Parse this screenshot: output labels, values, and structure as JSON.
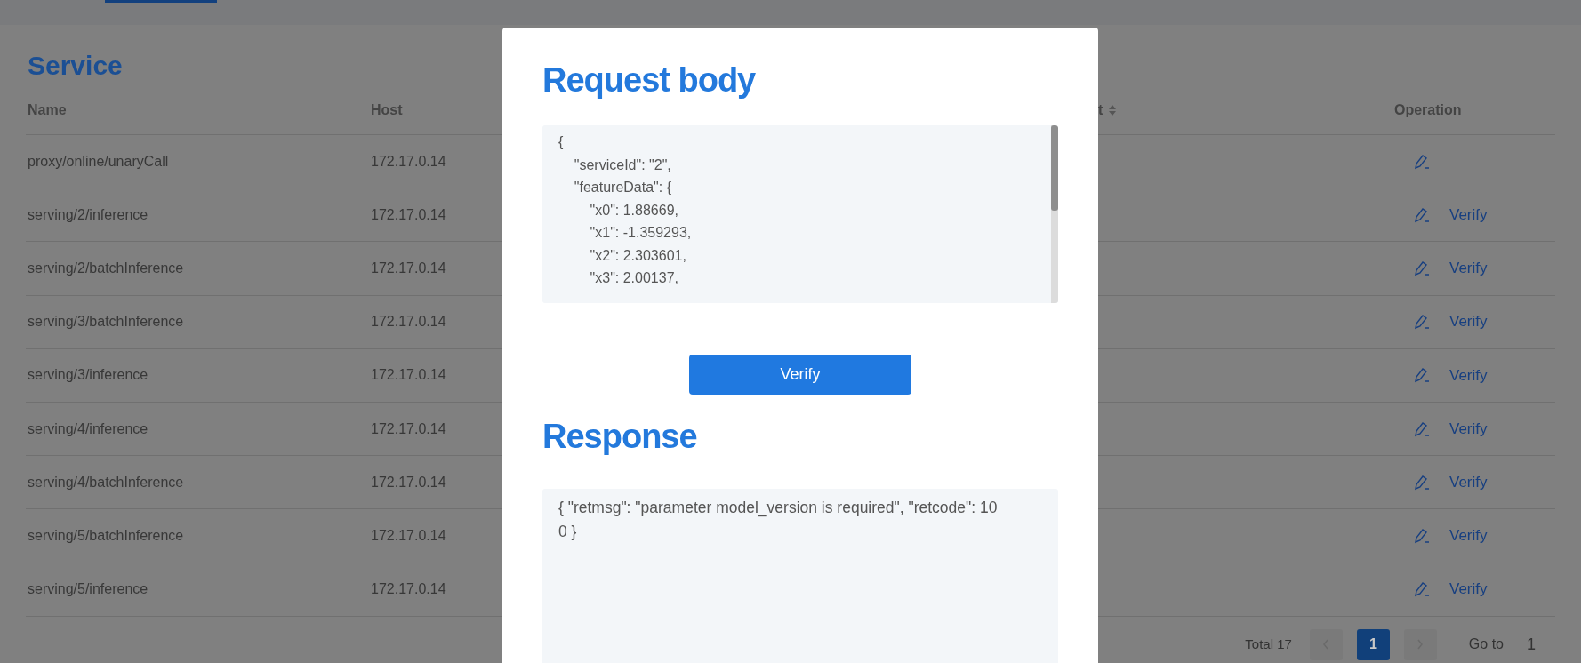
{
  "page": {
    "title": "Service"
  },
  "table": {
    "columns": [
      {
        "label": "Name",
        "kind": "plain"
      },
      {
        "label": "Host",
        "kind": "plain"
      },
      {
        "label": "t",
        "kind": "sortable"
      },
      {
        "label": "Operation",
        "kind": "plain"
      }
    ],
    "rows": [
      {
        "name": "proxy/online/unaryCall",
        "host": "172.17.0.14"
      },
      {
        "name": "serving/2/inference",
        "host": "172.17.0.14",
        "action": "Verify"
      },
      {
        "name": "serving/2/batchInference",
        "host": "172.17.0.14",
        "action": "Verify"
      },
      {
        "name": "serving/3/batchInference",
        "host": "172.17.0.14",
        "action": "Verify"
      },
      {
        "name": "serving/3/inference",
        "host": "172.17.0.14",
        "action": "Verify"
      },
      {
        "name": "serving/4/inference",
        "host": "172.17.0.14",
        "action": "Verify"
      },
      {
        "name": "serving/4/batchInference",
        "host": "172.17.0.14",
        "action": "Verify"
      },
      {
        "name": "serving/5/batchInference",
        "host": "172.17.0.14",
        "action": "Verify"
      },
      {
        "name": "serving/5/inference",
        "host": "172.17.0.14",
        "action": "Verify"
      }
    ]
  },
  "pagination": {
    "total": "Total 17",
    "pages": [
      {
        "label": "1",
        "selected": true
      }
    ],
    "goto_label": "Go to",
    "goto_value": "1"
  },
  "dialog": {
    "request_title": "Request body",
    "request_lines": [
      "{",
      "    \"serviceId\": \"2\",",
      "    \"featureData\": {",
      "        \"x0\": 1.88669,",
      "        \"x1\": -1.359293,",
      "        \"x2\": 2.303601,",
      "        \"x3\": 2.00137,"
    ],
    "button": "Verify",
    "response_title": "Response",
    "response_text": "{ \"retmsg\": \"parameter model_version is required\", \"retcode\": 100 }"
  }
}
